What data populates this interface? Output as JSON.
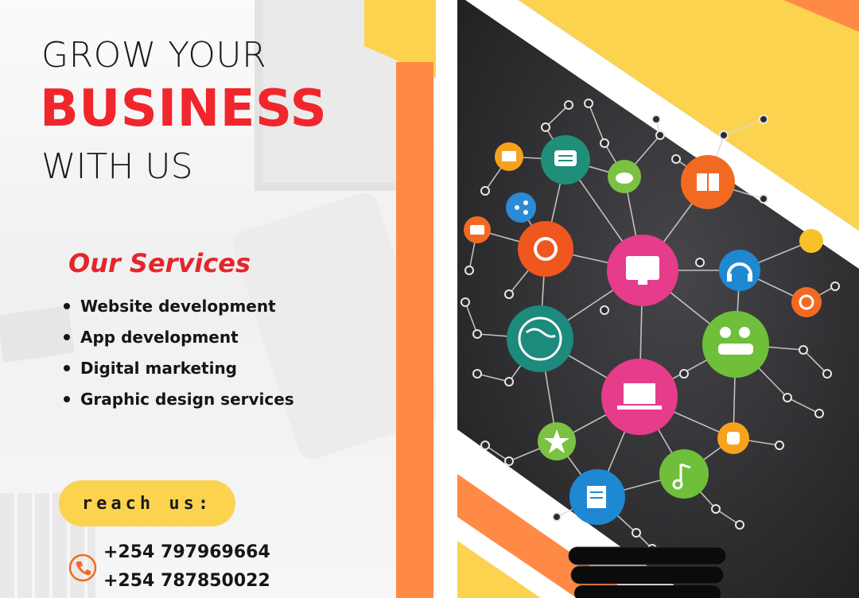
{
  "headline": {
    "line1": "GROW YOUR",
    "line2": "BUSINESS",
    "line3": "WITH US"
  },
  "services": {
    "title": "Our Services",
    "items": [
      "Website development",
      "App development",
      "Digital marketing",
      "Graphic design services"
    ]
  },
  "contact": {
    "reach_label": "reach us:",
    "phones": [
      "+254 797969664",
      "+254 787850022"
    ],
    "icon": "phone-icon"
  },
  "colors": {
    "headline_red": "#f0262c",
    "accent_yellow": "#fcd34f",
    "accent_orange": "#ff8a45",
    "panel_dark": "#2b2b2d"
  }
}
